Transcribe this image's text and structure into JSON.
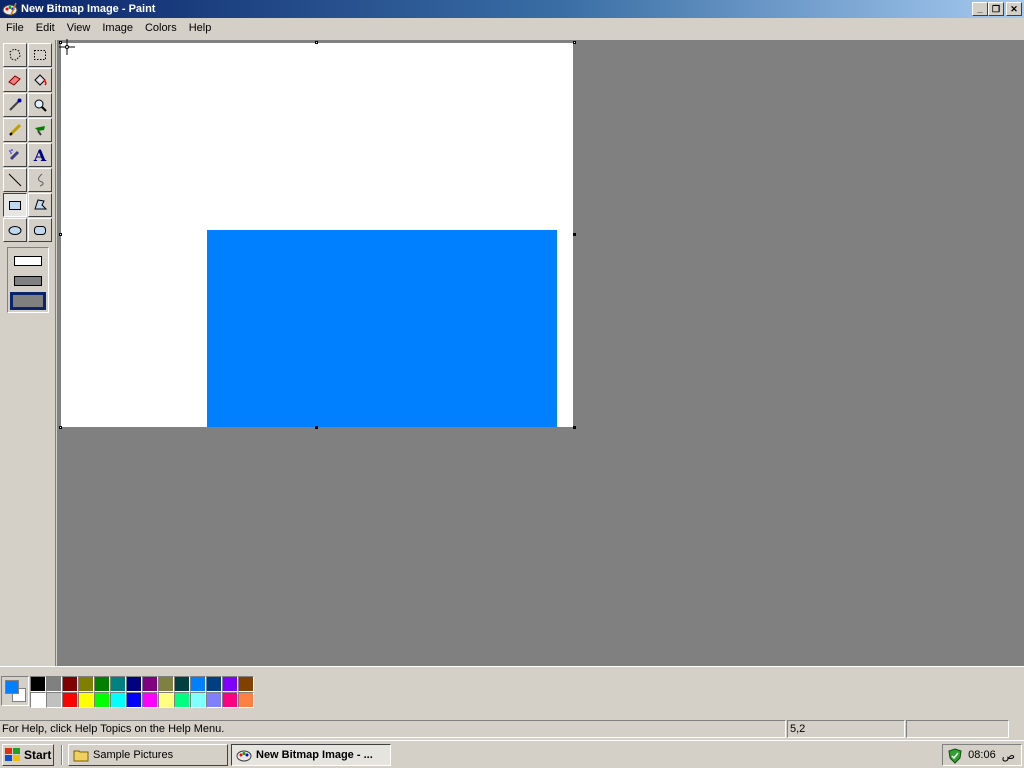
{
  "window": {
    "title": "New Bitmap Image - Paint",
    "buttons": {
      "minimize": "_",
      "restore": "❐",
      "close": "✕"
    }
  },
  "menu": [
    "File",
    "Edit",
    "View",
    "Image",
    "Colors",
    "Help"
  ],
  "tools": [
    {
      "name": "free-form-select",
      "icon": "free-form-select-icon"
    },
    {
      "name": "select",
      "icon": "select-icon"
    },
    {
      "name": "eraser",
      "icon": "eraser-icon"
    },
    {
      "name": "fill",
      "icon": "fill-bucket-icon"
    },
    {
      "name": "pick-color",
      "icon": "eyedropper-icon"
    },
    {
      "name": "magnifier",
      "icon": "magnifier-icon"
    },
    {
      "name": "pencil",
      "icon": "pencil-icon"
    },
    {
      "name": "brush",
      "icon": "brush-icon"
    },
    {
      "name": "airbrush",
      "icon": "airbrush-icon"
    },
    {
      "name": "text",
      "icon": "text-icon",
      "glyph": "A"
    },
    {
      "name": "line",
      "icon": "line-icon"
    },
    {
      "name": "curve",
      "icon": "curve-icon"
    },
    {
      "name": "rectangle",
      "icon": "rectangle-icon",
      "active": true
    },
    {
      "name": "polygon",
      "icon": "polygon-icon"
    },
    {
      "name": "ellipse",
      "icon": "ellipse-icon"
    },
    {
      "name": "rounded-rectangle",
      "icon": "rounded-rectangle-icon"
    }
  ],
  "fill_options": [
    "outline",
    "outline-and-fill",
    "fill-only"
  ],
  "canvas": {
    "background": "#ffffff",
    "shapes": [
      {
        "type": "rectangle",
        "fill": "#0080ff"
      }
    ]
  },
  "colors": {
    "foreground": "#0080ff",
    "background": "#ffffff",
    "palette_top": [
      "#000000",
      "#808080",
      "#800000",
      "#808000",
      "#008000",
      "#008080",
      "#000080",
      "#800080",
      "#808040",
      "#004040",
      "#0080ff",
      "#004080",
      "#8000ff",
      "#804000"
    ],
    "palette_bottom": [
      "#ffffff",
      "#c0c0c0",
      "#ff0000",
      "#ffff00",
      "#00ff00",
      "#00ffff",
      "#0000ff",
      "#ff00ff",
      "#ffff80",
      "#00ff80",
      "#80ffff",
      "#8080ff",
      "#ff0080",
      "#ff8040"
    ]
  },
  "status": {
    "help_text": "For Help, click Help Topics on the Help Menu.",
    "coords": "5,2",
    "size": ""
  },
  "taskbar": {
    "start_label": "Start",
    "tasks": [
      {
        "label": "Sample Pictures",
        "icon": "folder-icon",
        "active": false
      },
      {
        "label": "New Bitmap Image - ...",
        "icon": "paint-icon",
        "active": true
      }
    ],
    "clock": "08:06",
    "ampm": "ص"
  }
}
